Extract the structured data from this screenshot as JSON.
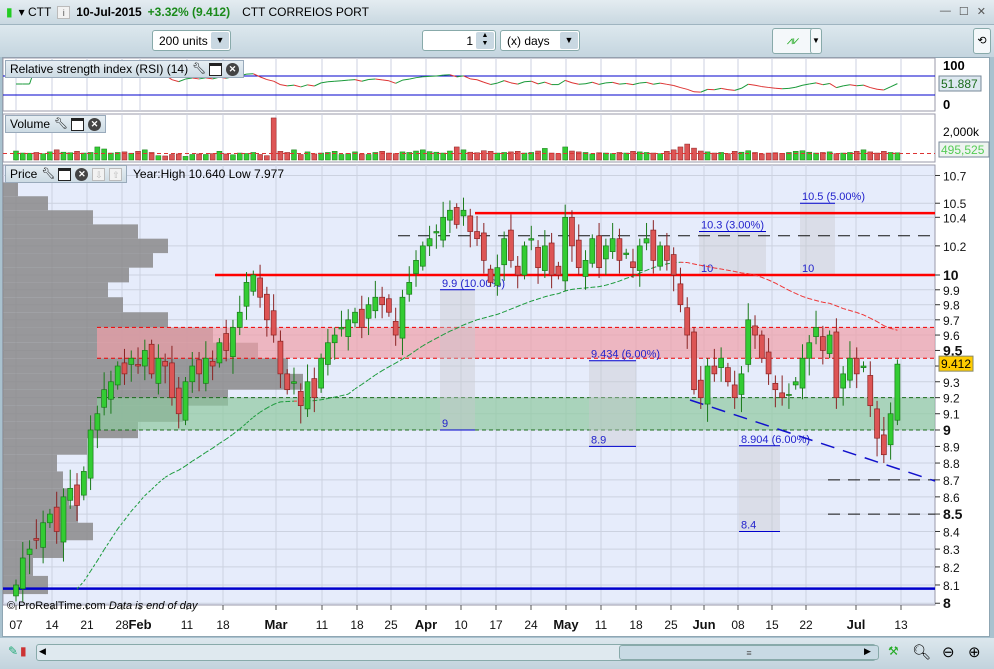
{
  "title": {
    "ticker": "CTT",
    "date": "10-Jul-2015",
    "change": "+3.32% (9.412)",
    "name": "CTT CORREIOS PORT"
  },
  "toolbar": {
    "units": "200 units",
    "interval_value": "1",
    "interval_unit": "(x) days"
  },
  "panels": {
    "rsi": {
      "label": "Relative strength index (RSI) (14)",
      "value": "51.887",
      "axis": [
        "100",
        "0"
      ]
    },
    "volume": {
      "label": "Volume",
      "value": "495,525",
      "axis": [
        "2,000k"
      ]
    },
    "price": {
      "label": "Price",
      "year_info": "Year:High 10.640 Low 7.977",
      "last": "9.412",
      "footer_brand": "© ProRealTime.com",
      "footer_note": "Data is end of day"
    }
  },
  "annotations": [
    {
      "top": "9.9 (10.00%)",
      "bottom": "9"
    },
    {
      "top": "9.434 (6.00%)",
      "bottom": "8.9"
    },
    {
      "top": "8.904 (6.00%)",
      "bottom": "8.4"
    },
    {
      "top": "10.3 (3.00%)",
      "bottom": "10"
    },
    {
      "top": "10.5 (5.00%)",
      "bottom": "10"
    }
  ],
  "colors": {
    "up": "#33cc33",
    "down": "#dd5555",
    "support": "#ff0000",
    "trend": "#0000cc"
  },
  "chart_data": {
    "type": "candlestick",
    "price_ticks": [
      "10.7",
      "10.5",
      "10.4",
      "10.2",
      "10",
      "9.9",
      "9.8",
      "9.7",
      "9.6",
      "9.5",
      "9.4",
      "9.3",
      "9.2",
      "9.1",
      "9",
      "8.9",
      "8.8",
      "8.7",
      "8.6",
      "8.5",
      "8.4",
      "8.3",
      "8.2",
      "8.1",
      "8"
    ],
    "x_ticks": [
      "07",
      "14",
      "21",
      "28",
      "Feb",
      "11",
      "18",
      "Mar",
      "11",
      "18",
      "25",
      "Apr",
      "10",
      "17",
      "24",
      "May",
      "11",
      "18",
      "25",
      "Jun",
      "08",
      "15",
      "22",
      "Jul",
      "13"
    ],
    "closes": [
      8.1,
      8.25,
      8.3,
      8.35,
      8.45,
      8.5,
      8.4,
      8.6,
      8.65,
      8.55,
      8.75,
      9.0,
      9.1,
      9.25,
      9.3,
      9.4,
      9.35,
      9.45,
      9.4,
      9.5,
      9.35,
      9.45,
      9.4,
      9.2,
      9.1,
      9.3,
      9.4,
      9.35,
      9.45,
      9.4,
      9.55,
      9.5,
      9.65,
      9.75,
      9.95,
      10.0,
      9.85,
      9.7,
      9.6,
      9.35,
      9.25,
      9.3,
      9.15,
      9.3,
      9.2,
      9.45,
      9.55,
      9.6,
      9.65,
      9.7,
      9.75,
      9.65,
      9.8,
      9.85,
      9.8,
      9.75,
      9.6,
      9.85,
      9.95,
      10.1,
      10.2,
      10.25,
      10.3,
      10.4,
      10.45,
      10.35,
      10.45,
      10.3,
      10.25,
      10.1,
      9.95,
      10.05,
      10.25,
      10.1,
      10.0,
      10.2,
      10.25,
      10.05,
      10.2,
      10.0,
      10.0,
      10.4,
      10.2,
      10.05,
      10.1,
      10.25,
      10.05,
      10.2,
      10.25,
      10.1,
      10.15,
      10.05,
      10.2,
      10.25,
      10.1,
      10.2,
      10.1,
      10.0,
      9.8,
      9.6,
      9.25,
      9.2,
      9.4,
      9.35,
      9.45,
      9.3,
      9.2,
      9.35,
      9.7,
      9.6,
      9.45,
      9.35,
      9.25,
      9.2,
      9.22,
      9.3,
      9.45,
      9.55,
      9.65,
      9.5,
      9.6,
      9.2,
      9.35,
      9.45,
      9.35,
      9.4,
      9.15,
      8.95,
      8.85,
      9.1,
      9.412
    ],
    "volumes_k": [
      620,
      480,
      470,
      520,
      430,
      560,
      700,
      540,
      500,
      600,
      480,
      520,
      900,
      760,
      480,
      520,
      560,
      470,
      600,
      700,
      520,
      300,
      280,
      380,
      420,
      250,
      380,
      420,
      380,
      440,
      600,
      420,
      360,
      480,
      450,
      520,
      380,
      300,
      2900,
      600,
      520,
      700,
      380,
      560,
      420,
      480,
      520,
      600,
      380,
      440,
      560,
      420,
      380,
      520,
      600,
      480,
      440,
      560,
      520,
      620,
      700,
      580,
      540,
      480,
      620,
      900,
      700,
      540,
      500,
      640,
      600,
      480,
      520,
      560,
      600,
      480,
      520,
      620,
      800,
      480,
      440,
      900,
      620,
      560,
      520,
      420,
      500,
      480,
      440,
      520,
      480,
      600,
      560,
      520,
      480,
      440,
      600,
      700,
      900,
      1100,
      820,
      620,
      560,
      480,
      520,
      440,
      600,
      540,
      640,
      520,
      420,
      480,
      500,
      460,
      520,
      600,
      640,
      540,
      480,
      520,
      560,
      440,
      480,
      520,
      600,
      700,
      560,
      480,
      600,
      520,
      495.5
    ],
    "levels": {
      "resistance": [
        10.43,
        10.0
      ],
      "dashed_blue": 10.27,
      "pink_zone": [
        9.45,
        9.65
      ],
      "green_zone": [
        9.0,
        9.2
      ],
      "blue_floor": 8.08,
      "black_dashed": [
        8.7,
        8.5
      ]
    },
    "volume_profile": {
      "prices": [
        8.1,
        8.2,
        8.3,
        8.4,
        8.5,
        8.6,
        8.7,
        8.8,
        8.9,
        9.0,
        9.1,
        9.2,
        9.3,
        9.4,
        9.5,
        9.6,
        9.7,
        9.8,
        9.9,
        10.0,
        10.1,
        10.2,
        10.3,
        10.4,
        10.5,
        10.6
      ],
      "relative": [
        0.15,
        0.1,
        0.2,
        0.3,
        0.25,
        0.22,
        0.2,
        0.18,
        0.28,
        0.45,
        0.6,
        0.75,
        1.0,
        0.95,
        0.85,
        0.7,
        0.55,
        0.4,
        0.35,
        0.42,
        0.5,
        0.55,
        0.45,
        0.3,
        0.15,
        0.05
      ]
    },
    "rsi_levels": [
      70,
      30
    ],
    "ylim": [
      7.95,
      10.75
    ],
    "scale": "log"
  }
}
